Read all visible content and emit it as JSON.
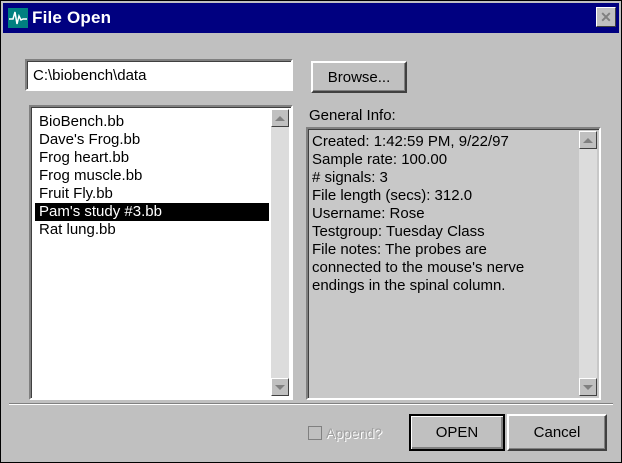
{
  "window": {
    "title": "File Open",
    "icon": "waveform-icon",
    "close_glyph": "✕"
  },
  "path_field": {
    "value": "C:\\biobench\\data"
  },
  "browse_button": {
    "label": "Browse..."
  },
  "file_list": {
    "items": [
      "BioBench.bb",
      "Dave's Frog.bb",
      "Frog heart.bb",
      "Frog muscle.bb",
      "Fruit Fly.bb",
      "Pam's study #3.bb",
      "Rat lung.bb"
    ],
    "selected_index": 5
  },
  "info": {
    "label": "General Info:",
    "lines": [
      "Created: 1:42:59 PM, 9/22/97",
      "Sample rate: 100.00",
      "# signals: 3",
      "File length (secs): 312.0",
      "Username: Rose",
      "Testgroup: Tuesday Class",
      "File notes: The probes are",
      "connected to the mouse's nerve",
      "endings in the spinal column."
    ]
  },
  "append": {
    "label": "Append?",
    "checked": false,
    "enabled": false
  },
  "buttons": {
    "open_label": "OPEN",
    "cancel_label": "Cancel"
  },
  "colors": {
    "titlebar": "#000080",
    "face": "#c0c0c0",
    "selection": "#000000"
  }
}
